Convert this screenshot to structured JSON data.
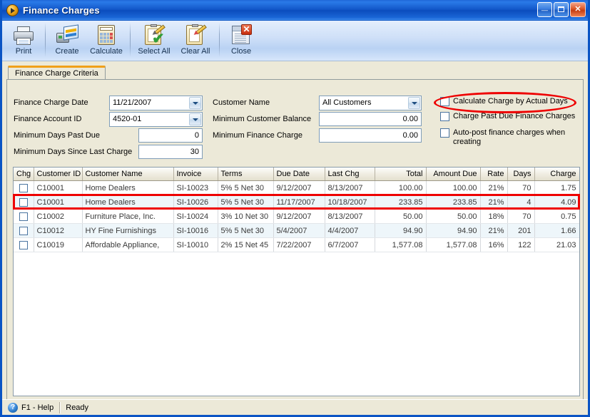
{
  "window": {
    "title": "Finance Charges",
    "icon": "orange-play-icon",
    "buttons": {
      "minimize": "minimize-button",
      "maximize": "maximize-button",
      "close": "close-button",
      "minimize_glyph": "_",
      "close_glyph": "✕"
    }
  },
  "toolbar": {
    "items": [
      {
        "label": "Print",
        "icon": "printer-icon"
      },
      {
        "label": "Create",
        "icon": "create-document-icon"
      },
      {
        "label": "Calculate",
        "icon": "calculator-icon"
      },
      {
        "label": "Select All",
        "icon": "select-all-checkmark-icon"
      },
      {
        "label": "Clear All",
        "icon": "clear-all-brush-icon"
      },
      {
        "label": "Close",
        "icon": "close-window-icon"
      }
    ]
  },
  "tabs": [
    {
      "label": "Finance Charge Criteria",
      "active": true
    }
  ],
  "criteria": {
    "left": [
      {
        "label": "Finance Charge Date",
        "value": "11/21/2007",
        "type": "combo"
      },
      {
        "label": "Finance Account ID",
        "value": "4520-01",
        "type": "combo"
      },
      {
        "label": "Minimum Days Past Due",
        "value": "0",
        "type": "number"
      },
      {
        "label": "Minimum Days Since Last Charge",
        "value": "30",
        "type": "number"
      }
    ],
    "middle": [
      {
        "label": "Customer Name",
        "value": "All Customers",
        "type": "combo"
      },
      {
        "label": "Minimum Customer Balance",
        "value": "0.00",
        "type": "number"
      },
      {
        "label": "Minimum Finance Charge",
        "value": "0.00",
        "type": "number"
      }
    ],
    "checkboxes": [
      {
        "label": "Calculate Charge by Actual Days",
        "checked": false,
        "highlighted": true
      },
      {
        "label": "Charge Past Due Finance Charges",
        "checked": false,
        "highlighted": false
      },
      {
        "label": "Auto-post finance charges when creating",
        "checked": false,
        "highlighted": false
      }
    ]
  },
  "grid": {
    "columns": [
      {
        "key": "chg",
        "label": "Chg",
        "align": "center"
      },
      {
        "key": "customer_id",
        "label": "Customer ID",
        "align": "left"
      },
      {
        "key": "customer_name",
        "label": "Customer Name",
        "align": "left"
      },
      {
        "key": "invoice",
        "label": "Invoice",
        "align": "left"
      },
      {
        "key": "terms",
        "label": "Terms",
        "align": "left"
      },
      {
        "key": "due_date",
        "label": "Due Date",
        "align": "left"
      },
      {
        "key": "last_chg",
        "label": "Last Chg",
        "align": "left"
      },
      {
        "key": "total",
        "label": "Total",
        "align": "right"
      },
      {
        "key": "amount_due",
        "label": "Amount Due",
        "align": "right"
      },
      {
        "key": "rate",
        "label": "Rate",
        "align": "right"
      },
      {
        "key": "days",
        "label": "Days",
        "align": "right"
      },
      {
        "key": "charge",
        "label": "Charge",
        "align": "right"
      }
    ],
    "rows": [
      {
        "chg": false,
        "customer_id": "C10001",
        "customer_name": "Home Dealers",
        "invoice": "SI-10023",
        "terms": "5% 5 Net 30",
        "due_date": "9/12/2007",
        "last_chg": "8/13/2007",
        "total": "100.00",
        "amount_due": "100.00",
        "rate": "21%",
        "days": "70",
        "charge": "1.75",
        "highlighted": false
      },
      {
        "chg": false,
        "customer_id": "C10001",
        "customer_name": "Home Dealers",
        "invoice": "SI-10026",
        "terms": "5% 5 Net 30",
        "due_date": "11/17/2007",
        "last_chg": "10/18/2007",
        "total": "233.85",
        "amount_due": "233.85",
        "rate": "21%",
        "days": "4",
        "charge": "4.09",
        "highlighted": true
      },
      {
        "chg": false,
        "customer_id": "C10002",
        "customer_name": "Furniture Place, Inc.",
        "invoice": "SI-10024",
        "terms": "3% 10 Net 30",
        "due_date": "9/12/2007",
        "last_chg": "8/13/2007",
        "total": "50.00",
        "amount_due": "50.00",
        "rate": "18%",
        "days": "70",
        "charge": "0.75",
        "highlighted": false
      },
      {
        "chg": false,
        "customer_id": "C10012",
        "customer_name": "HY Fine Furnishings",
        "invoice": "SI-10016",
        "terms": "5% 5 Net 30",
        "due_date": "5/4/2007",
        "last_chg": "4/4/2007",
        "total": "94.90",
        "amount_due": "94.90",
        "rate": "21%",
        "days": "201",
        "charge": "1.66",
        "highlighted": false
      },
      {
        "chg": false,
        "customer_id": "C10019",
        "customer_name": "Affordable Appliance,",
        "invoice": "SI-10010",
        "terms": "2% 15 Net 45",
        "due_date": "7/22/2007",
        "last_chg": "6/7/2007",
        "total": "1,577.08",
        "amount_due": "1,577.08",
        "rate": "16%",
        "days": "122",
        "charge": "21.03",
        "highlighted": false
      }
    ]
  },
  "statusbar": {
    "help": "F1 - Help",
    "status": "Ready"
  },
  "colors": {
    "title_blue": "#0b4cbd",
    "annotation_red": "#ee0000",
    "tab_accent": "#f0a019",
    "panel_beige": "#ece9d8",
    "row_alt": "#eef6fa"
  }
}
